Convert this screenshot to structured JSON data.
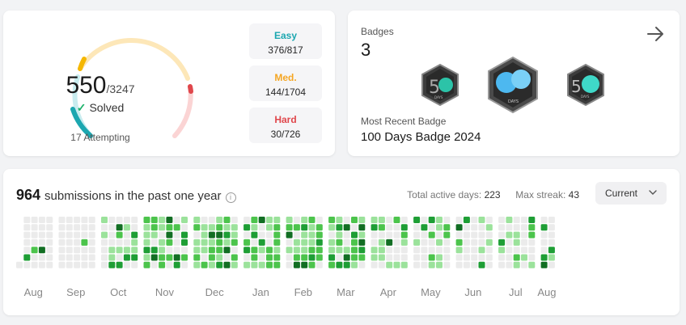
{
  "solved": {
    "solved_count": "550",
    "total_count": "/3247",
    "solved_label": "Solved",
    "attempting": "17 Attempting",
    "difficulties": [
      {
        "label": "Easy",
        "value": "376/817"
      },
      {
        "label": "Med.",
        "value": "144/1704"
      },
      {
        "label": "Hard",
        "value": "30/726"
      }
    ]
  },
  "badges": {
    "label": "Badges",
    "count": "3",
    "recent_label": "Most Recent Badge",
    "recent_name": "100 Days Badge 2024",
    "icons": [
      "50-days-badge-icon",
      "100-days-badge-icon",
      "50-days-badge-icon"
    ]
  },
  "submissions": {
    "count": "964",
    "text": "submissions in the past one year",
    "active_label": "Total active days:",
    "active_value": "223",
    "streak_label": "Max streak:",
    "streak_value": "43",
    "filter_value": "Current",
    "months": [
      "Aug",
      "Sep",
      "Oct",
      "Nov",
      "Dec",
      "Jan",
      "Feb",
      "Mar",
      "Apr",
      "May",
      "Jun",
      "Jul",
      "Aug"
    ]
  },
  "colors": {
    "easy": "#1ca7b0",
    "medium": "#f5a623",
    "hard": "#e0474c",
    "empty_cell": "#ebebeb",
    "level_1": "#9be29b",
    "level_2": "#4cc44c",
    "level_3": "#1e9e35",
    "level_4": "#126e23"
  }
}
